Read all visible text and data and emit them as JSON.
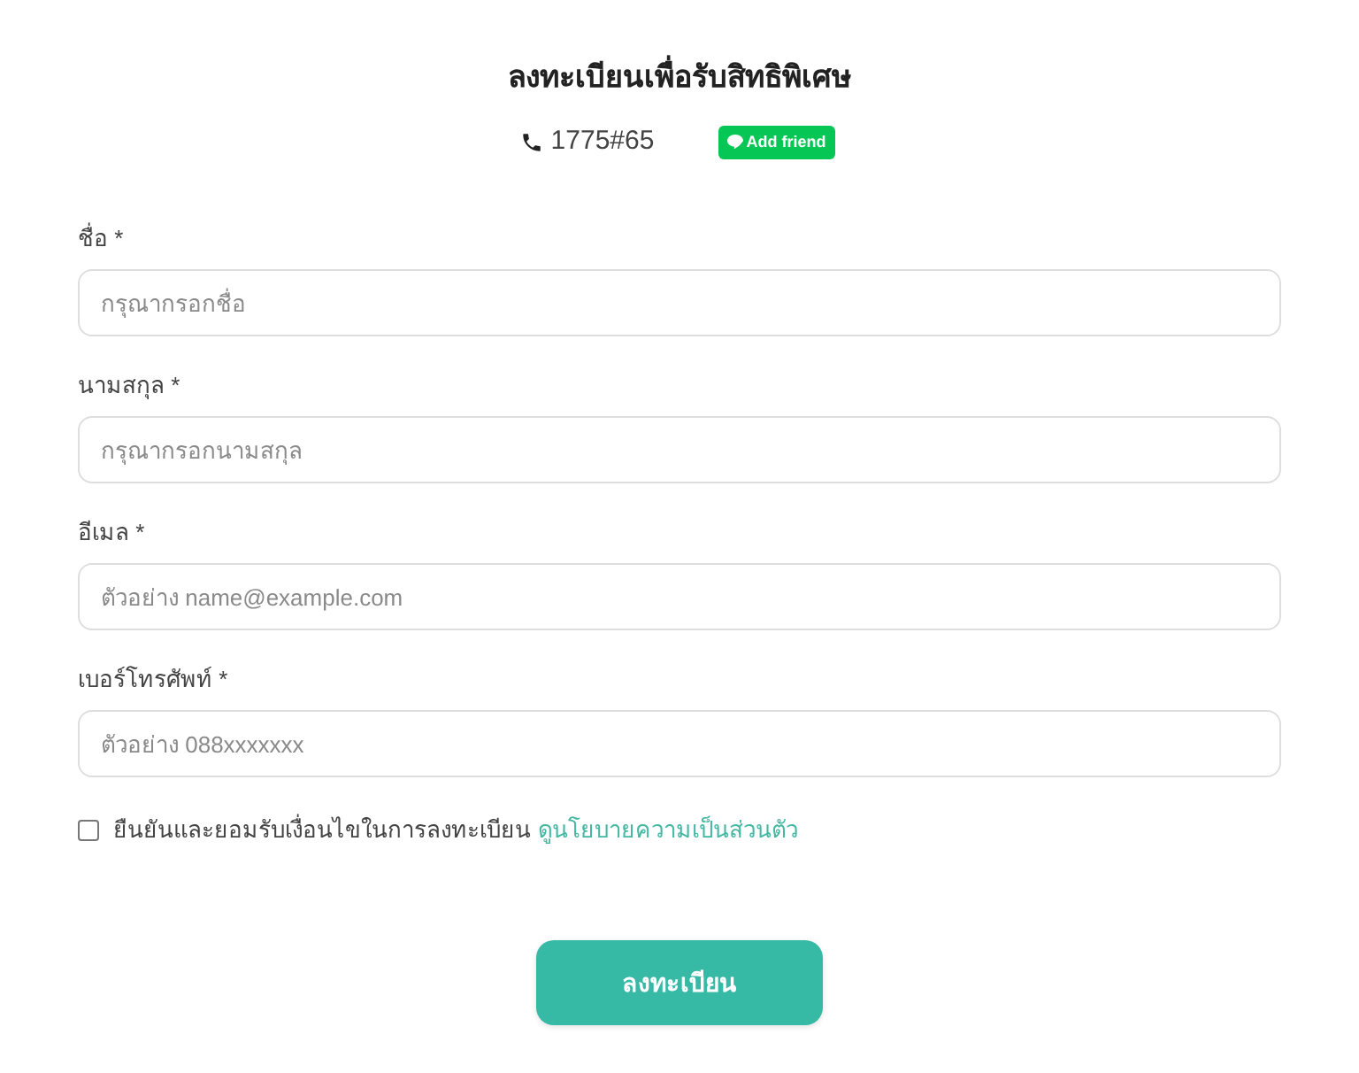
{
  "header": {
    "title": "ลงทะเบียนเพื่อรับสิทธิพิเศษ",
    "phone": "1775#65",
    "add_friend_button": "Add friend"
  },
  "fields": [
    {
      "label": "ชื่อ *",
      "placeholder": "กรุณากรอกชื่อ"
    },
    {
      "label": "นามสกุล *",
      "placeholder": "กรุณากรอกนามสกุล"
    },
    {
      "label": "อีเมล *",
      "placeholder": "ตัวอย่าง name@example.com"
    },
    {
      "label": "เบอร์โทรศัพท์ *",
      "placeholder": "ตัวอย่าง 088xxxxxxx"
    }
  ],
  "consent": {
    "checked": false,
    "text": "ยืนยันและยอมรับเงื่อนไขในการลงทะเบียน",
    "link": "ดูนโยบายความเป็นส่วนตัว"
  },
  "submit_button": "ลงทะเบียน"
}
